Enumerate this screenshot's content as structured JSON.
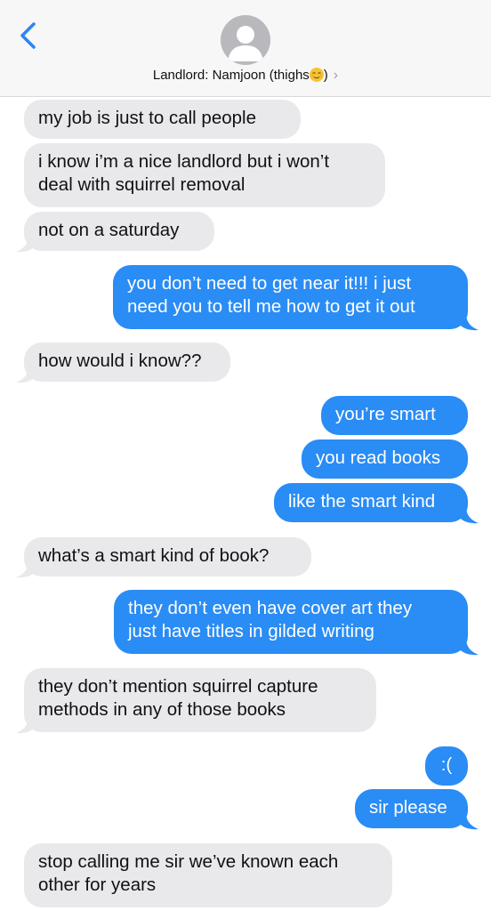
{
  "header": {
    "contact_name": "Landlord: Namjoon (thighs",
    "contact_suffix": ")",
    "chevron": "›",
    "back_icon": "chevron-left-icon",
    "accent_color": "#2d84f4"
  },
  "colors": {
    "incoming_bubble": "#e9e9eb",
    "outgoing_bubble": "#2a8cf5"
  },
  "messages": [
    {
      "from": "them",
      "line1": "my job is just to call people",
      "line2": ""
    },
    {
      "from": "them",
      "line1": "i know i’m a nice landlord but i won’t",
      "line2": "deal with squirrel removal"
    },
    {
      "from": "them",
      "line1": "not on a saturday",
      "line2": ""
    },
    {
      "from": "me",
      "line1": "you don’t need to get near it!!! i just",
      "line2": "need you to tell me how to get it out"
    },
    {
      "from": "them",
      "line1": "how would i know??",
      "line2": ""
    },
    {
      "from": "me",
      "line1": "you’re smart",
      "line2": ""
    },
    {
      "from": "me",
      "line1": "you read books",
      "line2": ""
    },
    {
      "from": "me",
      "line1": "like the smart kind",
      "line2": ""
    },
    {
      "from": "them",
      "line1": "what’s a smart kind of book?",
      "line2": ""
    },
    {
      "from": "me",
      "line1": "they don’t even have cover art they",
      "line2": "just have titles in gilded writing"
    },
    {
      "from": "them",
      "line1": "they don’t mention squirrel capture",
      "line2": "methods in any of those books"
    },
    {
      "from": "me",
      "line1": ":(",
      "line2": ""
    },
    {
      "from": "me",
      "line1": "sir please",
      "line2": ""
    },
    {
      "from": "them",
      "line1": "stop calling me sir we’ve known each",
      "line2": "other for years"
    }
  ]
}
